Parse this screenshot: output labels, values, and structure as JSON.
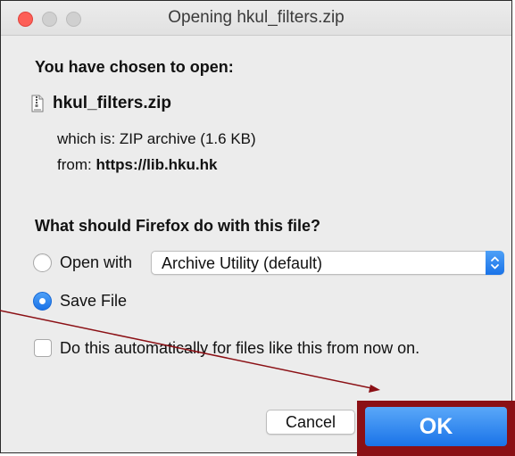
{
  "window": {
    "title": "Opening hkul_filters.zip"
  },
  "dialog": {
    "heading": "You have chosen to open:",
    "file_name": "hkul_filters.zip",
    "which_is_label": "which is:",
    "which_is_value": "ZIP archive (1.6 KB)",
    "from_label": "from:",
    "from_value": "https://lib.hku.hk",
    "question": "What should Firefox do with this file?",
    "open_with_label": "Open with",
    "open_with_selected": "Archive Utility (default)",
    "save_file_label": "Save File",
    "selected_option": "Save File",
    "auto_checkbox_label": "Do this automatically for files like this from now on.",
    "auto_checkbox_checked": false
  },
  "buttons": {
    "cancel": "Cancel",
    "ok": "OK"
  },
  "colors": {
    "accent": "#1a73e8",
    "highlight": "#8b1015",
    "annotation_arrow": "#8b1015"
  },
  "icons": {
    "file": "zip-file-icon",
    "select": "chevron-updown-icon"
  }
}
